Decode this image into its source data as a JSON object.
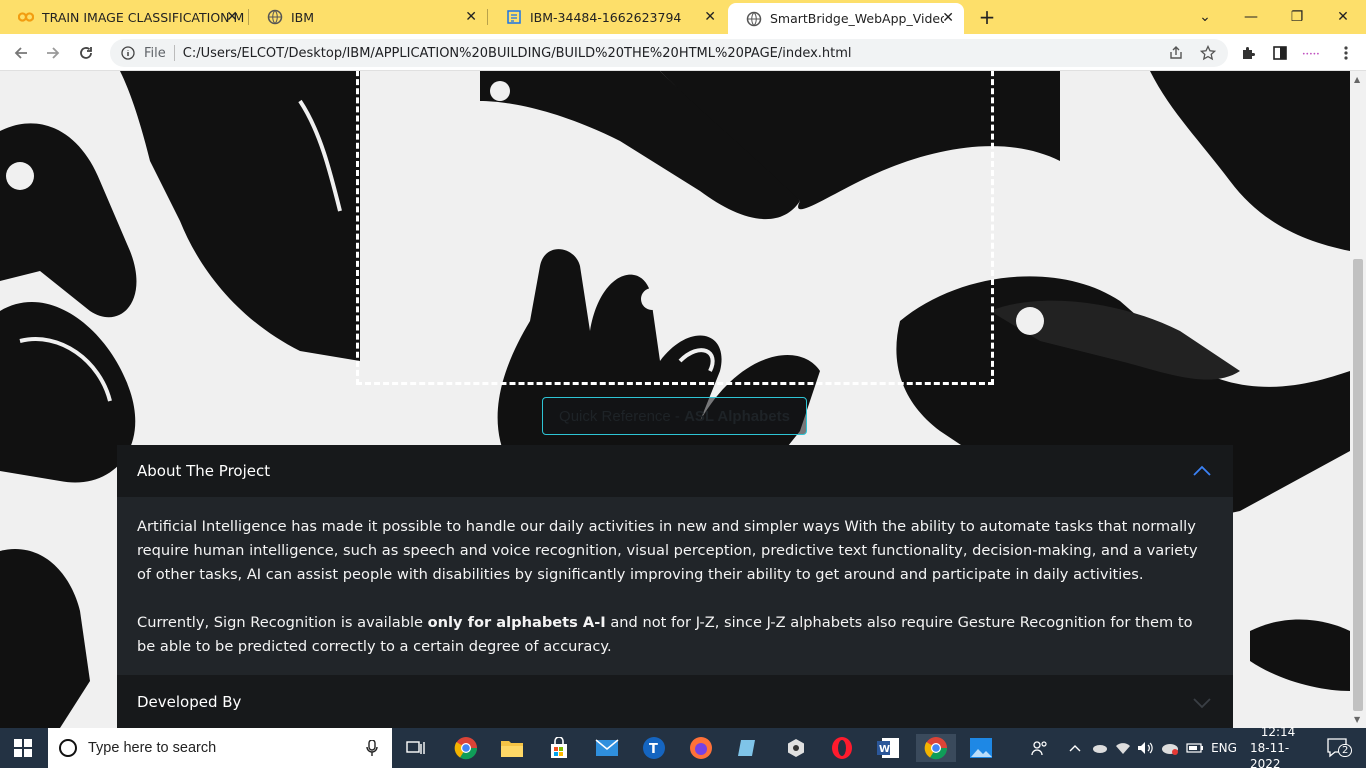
{
  "browser": {
    "tabs": [
      {
        "title": "TRAIN IMAGE CLASSIFICATION M",
        "icon": "colab-icon",
        "active": false
      },
      {
        "title": "IBM",
        "icon": "globe-icon",
        "active": false
      },
      {
        "title": "IBM-34484-1662623794",
        "icon": "ibm-doc-icon",
        "active": false
      },
      {
        "title": "SmartBridge_WebApp_VideoTem",
        "icon": "globe-icon",
        "active": true
      }
    ],
    "new_tab_label": "+",
    "address_prefix": "File",
    "url": "C:/Users/ELCOT/Desktop/IBM/APPLICATION%20BUILDING/BUILD%20THE%20HTML%20PAGE/index.html",
    "window_controls": {
      "minimize": "—",
      "restore": "❐",
      "close": "✕",
      "dropdown": "⌄"
    }
  },
  "page": {
    "quick_reference": {
      "prefix": "Quick Reference - ",
      "bold": "ASL Alphabets"
    },
    "accordion": {
      "about_title": "About The Project",
      "about_paragraph_1": "Artificial Intelligence has made it possible to handle our daily activities in new and simpler ways With the ability to automate tasks that normally require human intelligence, such as speech and voice recognition, visual perception, predictive text functionality, decision-making, and a variety of other tasks, AI can assist people with disabilities by significantly improving their ability to get around and participate in daily activities.",
      "about_paragraph_2_pre": "Currently, Sign Recognition is available ",
      "about_paragraph_2_bold": "only for alphabets A-I",
      "about_paragraph_2_post": " and not for J-Z, since J-Z alphabets also require Gesture Recognition for them to be able to be predicted correctly to a certain degree of accuracy.",
      "developed_title": "Developed By"
    },
    "colors": {
      "accordion_bg": "#212529",
      "accordion_header": "#17191b",
      "accent": "#2ec4d4",
      "chevron_active": "#3b82f6"
    }
  },
  "taskbar": {
    "search_placeholder": "Type here to search",
    "language": "ENG",
    "time": "12:14",
    "date": "18-11-2022",
    "notification_count": "2",
    "apps": [
      "chrome-icon",
      "file-explorer-icon",
      "store-icon",
      "mail-icon",
      "tool-icon",
      "firefox-icon",
      "notes-icon",
      "settings-icon",
      "opera-icon",
      "word-icon",
      "chrome-active-icon",
      "photos-icon"
    ]
  }
}
